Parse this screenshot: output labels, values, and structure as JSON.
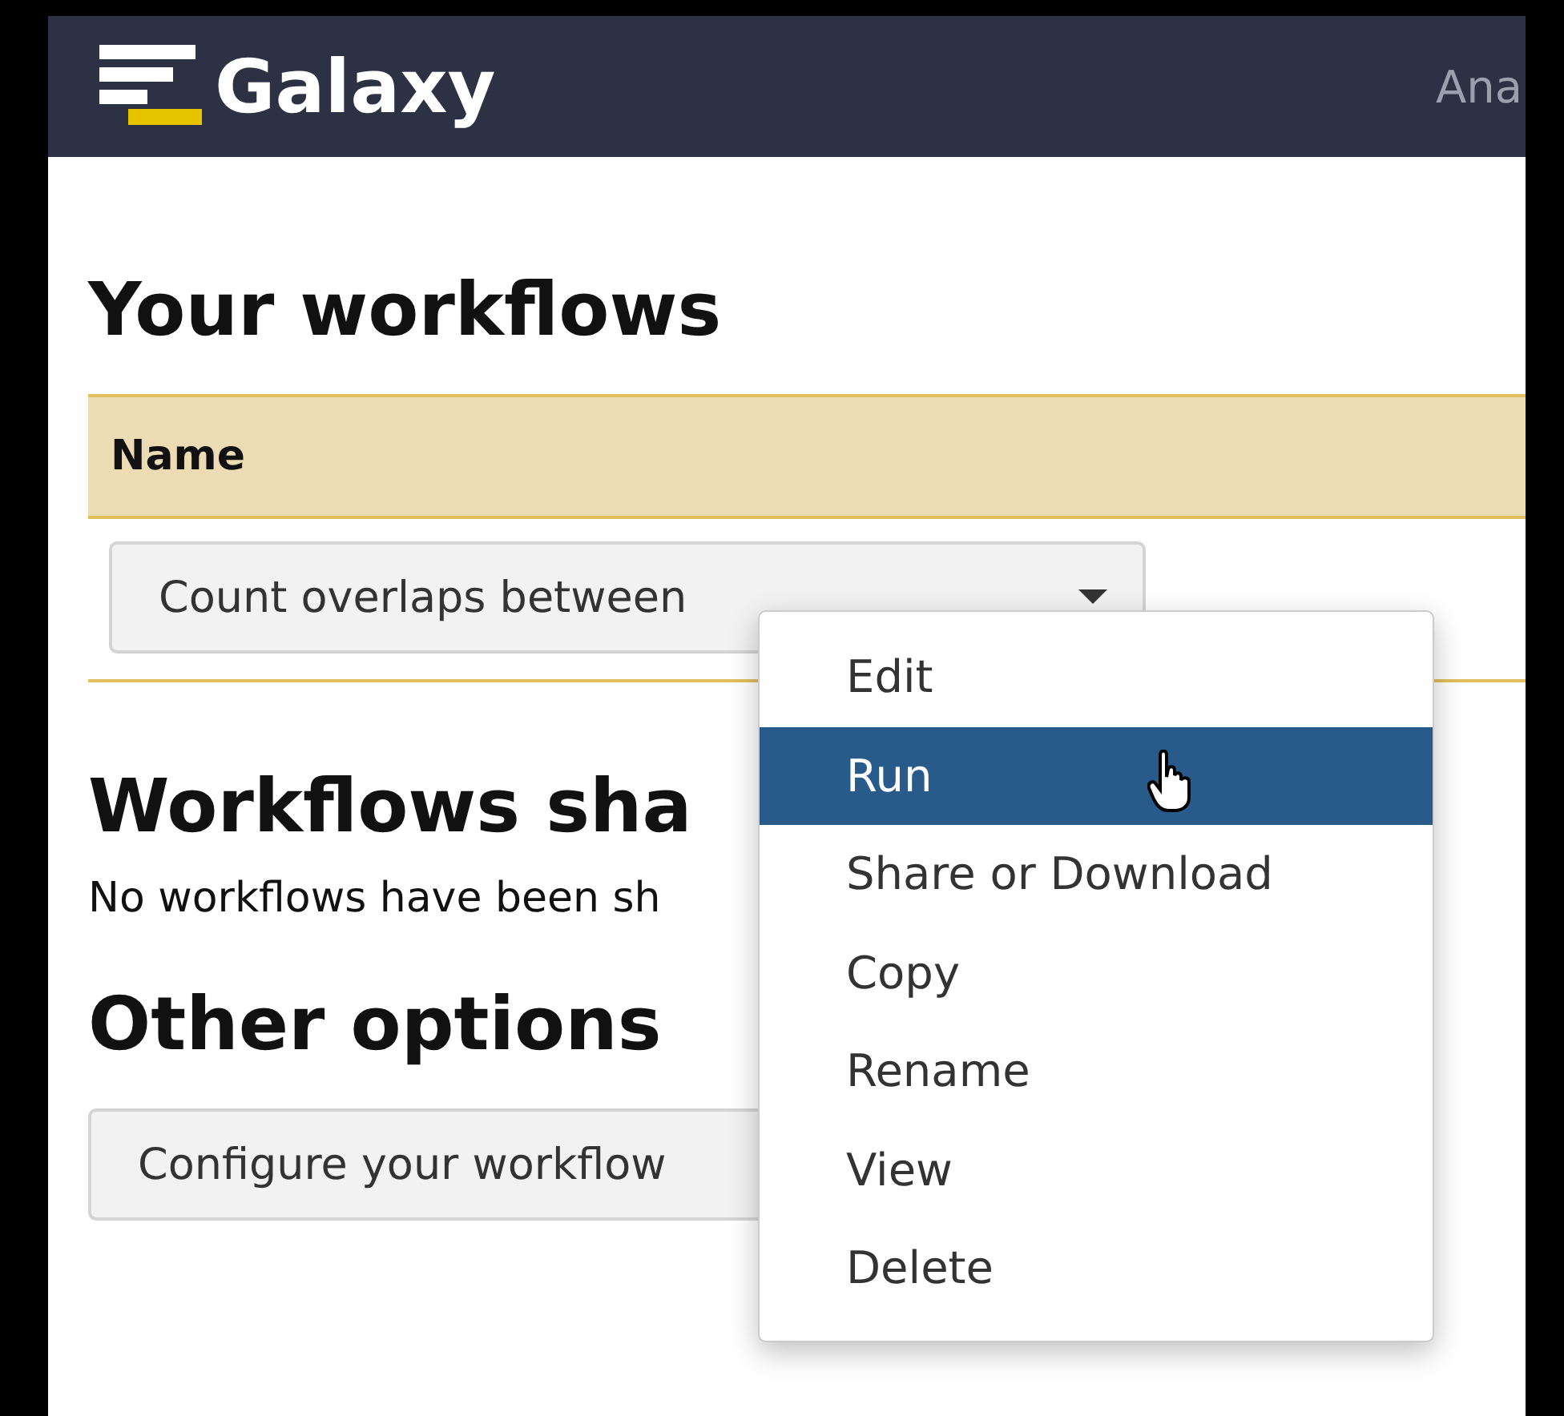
{
  "navbar": {
    "brand": "Galaxy",
    "nav_item": "Ana"
  },
  "your_workflows": {
    "heading": "Your workflows",
    "table": {
      "columns": [
        "Name"
      ],
      "rows": [
        {
          "name": "Count overlaps between"
        }
      ]
    }
  },
  "shared": {
    "heading": "Workflows sha",
    "message": "No workflows have been sh"
  },
  "other": {
    "heading": "Other options",
    "button": "Configure your workflow"
  },
  "menu": {
    "items": [
      {
        "label": "Edit",
        "selected": false
      },
      {
        "label": "Run",
        "selected": true
      },
      {
        "label": "Share or Download",
        "selected": false
      },
      {
        "label": "Copy",
        "selected": false
      },
      {
        "label": "Rename",
        "selected": false
      },
      {
        "label": "View",
        "selected": false
      },
      {
        "label": "Delete",
        "selected": false
      }
    ]
  }
}
